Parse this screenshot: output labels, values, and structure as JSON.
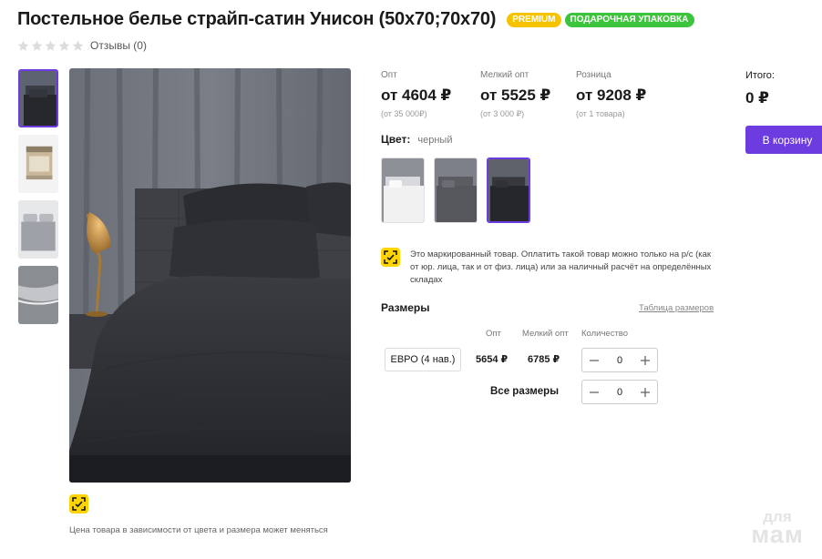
{
  "product": {
    "title": "Постельное белье страйп-сатин Унисон (50х70;70х70)",
    "badges": {
      "premium": "PREMIUM",
      "gift": "ПОДАРОЧНАЯ УПАКОВКА"
    },
    "rating": {
      "stars": 0,
      "max": 5,
      "reviews_label": "Отзывы (0)"
    }
  },
  "gallery": {
    "thumbnails": [
      "bed-dark-grey",
      "package-box",
      "bed-light-grey",
      "fabric-closeup"
    ],
    "active_index": 0,
    "note": "Цена товара в зависимости от цвета и размера может меняться"
  },
  "prices": [
    {
      "label": "Опт",
      "value": "от 4604 ₽",
      "condition": "(от 35 000₽)"
    },
    {
      "label": "Мелкий опт",
      "value": "от 5525 ₽",
      "condition": "(от 3 000 ₽)"
    },
    {
      "label": "Розница",
      "value": "от 9208 ₽",
      "condition": "(от 1 товара)"
    }
  ],
  "total": {
    "label": "Итого:",
    "value": "0 ₽"
  },
  "cart_button": "В корзину",
  "color": {
    "label": "Цвет:",
    "value": "черный",
    "swatches": [
      "white",
      "grey",
      "black"
    ],
    "active_index": 2
  },
  "marking_notice": "Это маркированный товар. Оплатить такой товар можно только на р/с (как от юр. лица, так и от физ. лица) или за наличный расчёт на определённых складах",
  "sizes": {
    "title": "Размеры",
    "table_link": "Таблица размеров",
    "headers": {
      "opt": "Опт",
      "small_opt": "Мелкий опт",
      "qty": "Количество"
    },
    "rows": [
      {
        "name": "ЕВРО (4 нав.)",
        "opt": "5654 ₽",
        "small_opt": "6785 ₽",
        "qty": "0"
      }
    ],
    "all_sizes_label": "Все размеры",
    "all_sizes_qty": "0"
  },
  "watermark": {
    "line1": "для",
    "line2": "мам"
  },
  "colors": {
    "accent": "#6c3ce0",
    "premium": "#f7c300",
    "gift": "#3cc43c",
    "marking": "#ffd400"
  }
}
